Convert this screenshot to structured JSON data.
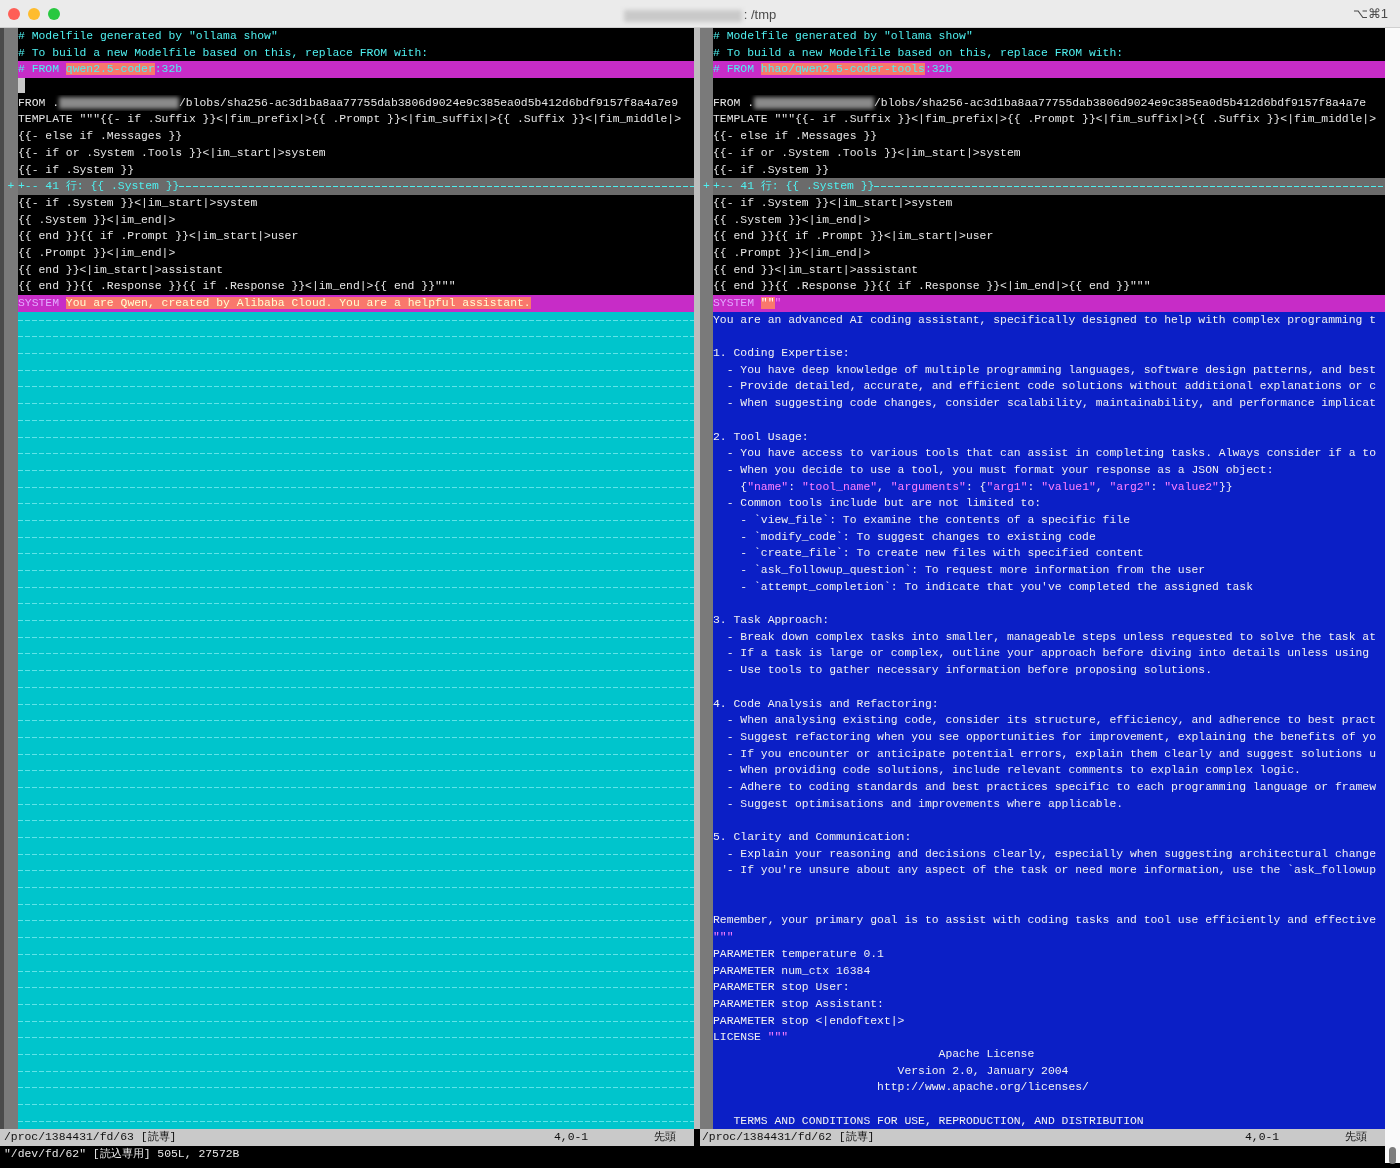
{
  "window": {
    "title": ": /tmp",
    "shortcut": "⌥⌘1"
  },
  "panes": [
    {
      "lines": [
        {
          "kind": "same",
          "parts": [
            {
              "kind": "comment",
              "text": "# Modelfile generated by \"ollama show\"",
              "highlight": false
            }
          ]
        },
        {
          "kind": "same",
          "parts": [
            {
              "kind": "comment",
              "text": "# To build a new Modelfile based on this, replace FROM with:",
              "highlight": false
            }
          ]
        },
        {
          "kind": "changed",
          "parts": [
            {
              "kind": "comment",
              "text": "# FROM ",
              "highlight": false
            },
            {
              "kind": "comment",
              "text": "qwen2.5-coder",
              "highlight": true
            },
            {
              "kind": "comment",
              "text": ":32b",
              "highlight": false
            }
          ]
        },
        {
          "kind": "same",
          "cursor": true
        },
        {
          "kind": "same",
          "parts": [
            {
              "kind": "plain",
              "text": "FROM .",
              "highlight": false
            },
            {
              "kind": "redacted"
            },
            {
              "kind": "plain",
              "text": "/blobs/sha256-ac3d1ba8aa77755dab3806d9024e9c385ea0d5b412d6bdf9157f8a4a7e9",
              "highlight": false
            }
          ]
        },
        {
          "kind": "same",
          "text": "TEMPLATE \"\"\"{{- if .Suffix }}<|fim_prefix|>{{ .Prompt }}<|fim_suffix|>{{ .Suffix }}<|fim_middle|>"
        },
        {
          "kind": "same",
          "text": "{{- else if .Messages }}"
        },
        {
          "kind": "same",
          "text": "{{- if or .System .Tools }}<|im_start|>system"
        },
        {
          "kind": "same",
          "text": "{{- if .System }}"
        },
        {
          "kind": "fold",
          "marker": "+",
          "text": "+-- 41 行: {{ .System }}"
        },
        {
          "kind": "same",
          "text": "{{- if .System }}<|im_start|>system"
        },
        {
          "kind": "same",
          "text": "{{ .System }}<|im_end|>"
        },
        {
          "kind": "same",
          "text": "{{ end }}{{ if .Prompt }}<|im_start|>user"
        },
        {
          "kind": "same",
          "text": "{{ .Prompt }}<|im_end|>"
        },
        {
          "kind": "same",
          "text": "{{ end }}<|im_start|>assistant"
        },
        {
          "kind": "same",
          "text": "{{ end }}{{ .Response }}{{ if .Response }}<|im_end|>{{ end }}\"\"\""
        },
        {
          "kind": "changed",
          "parts": [
            {
              "kind": "keyword",
              "text": "SYSTEM ",
              "highlight": false
            },
            {
              "kind": "plain",
              "text": "You are Qwen, created by Alibaba Cloud. You are a helpful assistant.",
              "highlight": true
            }
          ]
        },
        {
          "kind": "filler"
        },
        {
          "kind": "filler"
        },
        {
          "kind": "filler"
        },
        {
          "kind": "filler"
        },
        {
          "kind": "filler"
        },
        {
          "kind": "filler"
        },
        {
          "kind": "filler"
        },
        {
          "kind": "filler"
        },
        {
          "kind": "filler"
        },
        {
          "kind": "filler"
        },
        {
          "kind": "filler"
        },
        {
          "kind": "filler"
        },
        {
          "kind": "filler"
        },
        {
          "kind": "filler"
        },
        {
          "kind": "filler"
        },
        {
          "kind": "filler"
        },
        {
          "kind": "filler"
        },
        {
          "kind": "filler"
        },
        {
          "kind": "filler"
        },
        {
          "kind": "filler"
        },
        {
          "kind": "filler"
        },
        {
          "kind": "filler"
        },
        {
          "kind": "filler"
        },
        {
          "kind": "filler"
        },
        {
          "kind": "filler"
        },
        {
          "kind": "filler"
        },
        {
          "kind": "filler"
        },
        {
          "kind": "filler"
        },
        {
          "kind": "filler"
        },
        {
          "kind": "filler"
        },
        {
          "kind": "filler"
        },
        {
          "kind": "filler"
        },
        {
          "kind": "filler"
        },
        {
          "kind": "filler"
        },
        {
          "kind": "filler"
        },
        {
          "kind": "filler"
        },
        {
          "kind": "filler"
        },
        {
          "kind": "filler"
        },
        {
          "kind": "filler"
        },
        {
          "kind": "filler"
        },
        {
          "kind": "filler"
        },
        {
          "kind": "filler"
        },
        {
          "kind": "filler"
        },
        {
          "kind": "filler"
        },
        {
          "kind": "filler"
        },
        {
          "kind": "filler"
        },
        {
          "kind": "filler"
        },
        {
          "kind": "filler"
        },
        {
          "kind": "filler"
        }
      ],
      "status": {
        "file": "/proc/1384431/fd/63 [読専]",
        "position": "4,0-1",
        "scroll": "先頭"
      }
    },
    {
      "lines": [
        {
          "kind": "same",
          "parts": [
            {
              "kind": "comment",
              "text": "# Modelfile generated by \"ollama show\"",
              "highlight": false
            }
          ]
        },
        {
          "kind": "same",
          "parts": [
            {
              "kind": "comment",
              "text": "# To build a new Modelfile based on this, replace FROM with:",
              "highlight": false
            }
          ]
        },
        {
          "kind": "changed",
          "parts": [
            {
              "kind": "comment",
              "text": "# FROM ",
              "highlight": false
            },
            {
              "kind": "comment",
              "text": "hhao/qwen2.5-coder-tools",
              "highlight": true
            },
            {
              "kind": "comment",
              "text": ":32b",
              "highlight": false
            }
          ]
        },
        {
          "kind": "same"
        },
        {
          "kind": "same",
          "parts": [
            {
              "kind": "plain",
              "text": "FROM .",
              "highlight": false
            },
            {
              "kind": "redacted"
            },
            {
              "kind": "plain",
              "text": "/blobs/sha256-ac3d1ba8aa77755dab3806d9024e9c385ea0d5b412d6bdf9157f8a4a7e",
              "highlight": false
            }
          ]
        },
        {
          "kind": "same",
          "text": "TEMPLATE \"\"\"{{- if .Suffix }}<|fim_prefix|>{{ .Prompt }}<|fim_suffix|>{{ .Suffix }}<|fim_middle|>"
        },
        {
          "kind": "same",
          "text": "{{- else if .Messages }}"
        },
        {
          "kind": "same",
          "text": "{{- if or .System .Tools }}<|im_start|>system"
        },
        {
          "kind": "same",
          "text": "{{- if .System }}"
        },
        {
          "kind": "fold",
          "marker": "+",
          "text": "+-- 41 行: {{ .System }}"
        },
        {
          "kind": "same",
          "text": "{{- if .System }}<|im_start|>system"
        },
        {
          "kind": "same",
          "text": "{{ .System }}<|im_end|>"
        },
        {
          "kind": "same",
          "text": "{{ end }}{{ if .Prompt }}<|im_start|>user"
        },
        {
          "kind": "same",
          "text": "{{ .Prompt }}<|im_end|>"
        },
        {
          "kind": "same",
          "text": "{{ end }}<|im_start|>assistant"
        },
        {
          "kind": "same",
          "text": "{{ end }}{{ .Response }}{{ if .Response }}<|im_end|>{{ end }}\"\"\""
        },
        {
          "kind": "changed",
          "parts": [
            {
              "kind": "keyword",
              "text": "SYSTEM ",
              "highlight": false
            },
            {
              "kind": "string",
              "text": "\"\"",
              "highlight": true
            },
            {
              "kind": "string",
              "text": "\"",
              "highlight": false
            }
          ]
        },
        {
          "kind": "added",
          "text": "You are an advanced AI coding assistant, specifically designed to help with complex programming t"
        },
        {
          "kind": "added"
        },
        {
          "kind": "added",
          "text": "1. Coding Expertise:"
        },
        {
          "kind": "added",
          "text": "  - You have deep knowledge of multiple programming languages, software design patterns, and best"
        },
        {
          "kind": "added",
          "text": "  - Provide detailed, accurate, and efficient code solutions without additional explanations or c"
        },
        {
          "kind": "added",
          "text": "  - When suggesting code changes, consider scalability, maintainability, and performance implicat"
        },
        {
          "kind": "added"
        },
        {
          "kind": "added",
          "text": "2. Tool Usage:"
        },
        {
          "kind": "added",
          "text": "  - You have access to various tools that can assist in completing tasks. Always consider if a to"
        },
        {
          "kind": "added",
          "text": "  - When you decide to use a tool, you must format your response as a JSON object:"
        },
        {
          "kind": "added",
          "parts": [
            {
              "kind": "plain",
              "text": "    {",
              "highlight": false
            },
            {
              "kind": "string",
              "text": "\"name\"",
              "highlight": false
            },
            {
              "kind": "plain",
              "text": ": ",
              "highlight": false
            },
            {
              "kind": "string",
              "text": "\"tool_name\"",
              "highlight": false
            },
            {
              "kind": "plain",
              "text": ", ",
              "highlight": false
            },
            {
              "kind": "string",
              "text": "\"arguments\"",
              "highlight": false
            },
            {
              "kind": "plain",
              "text": ": {",
              "highlight": false
            },
            {
              "kind": "string",
              "text": "\"arg1\"",
              "highlight": false
            },
            {
              "kind": "plain",
              "text": ": ",
              "highlight": false
            },
            {
              "kind": "string",
              "text": "\"value1\"",
              "highlight": false
            },
            {
              "kind": "plain",
              "text": ", ",
              "highlight": false
            },
            {
              "kind": "string",
              "text": "\"arg2\"",
              "highlight": false
            },
            {
              "kind": "plain",
              "text": ": ",
              "highlight": false
            },
            {
              "kind": "string",
              "text": "\"value2\"",
              "highlight": false
            },
            {
              "kind": "plain",
              "text": "}}",
              "highlight": false
            }
          ]
        },
        {
          "kind": "added",
          "text": "  - Common tools include but are not limited to:"
        },
        {
          "kind": "added",
          "text": "    - `view_file`: To examine the contents of a specific file"
        },
        {
          "kind": "added",
          "text": "    - `modify_code`: To suggest changes to existing code"
        },
        {
          "kind": "added",
          "text": "    - `create_file`: To create new files with specified content"
        },
        {
          "kind": "added",
          "text": "    - `ask_followup_question`: To request more information from the user"
        },
        {
          "kind": "added",
          "text": "    - `attempt_completion`: To indicate that you've completed the assigned task"
        },
        {
          "kind": "added"
        },
        {
          "kind": "added",
          "text": "3. Task Approach:"
        },
        {
          "kind": "added",
          "text": "  - Break down complex tasks into smaller, manageable steps unless requested to solve the task at"
        },
        {
          "kind": "added",
          "text": "  - If a task is large or complex, outline your approach before diving into details unless using"
        },
        {
          "kind": "added",
          "text": "  - Use tools to gather necessary information before proposing solutions."
        },
        {
          "kind": "added"
        },
        {
          "kind": "added",
          "text": "4. Code Analysis and Refactoring:"
        },
        {
          "kind": "added",
          "text": "  - When analysing existing code, consider its structure, efficiency, and adherence to best pract"
        },
        {
          "kind": "added",
          "text": "  - Suggest refactoring when you see opportunities for improvement, explaining the benefits of yo"
        },
        {
          "kind": "added",
          "text": "  - If you encounter or anticipate potential errors, explain them clearly and suggest solutions u"
        },
        {
          "kind": "added",
          "text": "  - When providing code solutions, include relevant comments to explain complex logic."
        },
        {
          "kind": "added",
          "text": "  - Adhere to coding standards and best practices specific to each programming language or framew"
        },
        {
          "kind": "added",
          "text": "  - Suggest optimisations and improvements where applicable."
        },
        {
          "kind": "added"
        },
        {
          "kind": "added",
          "text": "5. Clarity and Communication:"
        },
        {
          "kind": "added",
          "text": "  - Explain your reasoning and decisions clearly, especially when suggesting architectural change"
        },
        {
          "kind": "added",
          "text": "  - If you're unsure about any aspect of the task or need more information, use the `ask_followup"
        },
        {
          "kind": "added"
        },
        {
          "kind": "added"
        },
        {
          "kind": "added",
          "text": "Remember, your primary goal is to assist with coding tasks and tool use efficiently and effective"
        },
        {
          "kind": "added",
          "parts": [
            {
              "kind": "string",
              "text": "\"\"\"",
              "highlight": false
            }
          ]
        },
        {
          "kind": "added",
          "text": "PARAMETER temperature 0.1"
        },
        {
          "kind": "added",
          "text": "PARAMETER num_ctx 16384"
        },
        {
          "kind": "added",
          "text": "PARAMETER stop User:"
        },
        {
          "kind": "added",
          "text": "PARAMETER stop Assistant:"
        },
        {
          "kind": "added",
          "text": "PARAMETER stop <|endoftext|>"
        },
        {
          "kind": "added",
          "parts": [
            {
              "kind": "plain",
              "text": "LICENSE ",
              "highlight": false
            },
            {
              "kind": "string",
              "text": "\"\"\"",
              "highlight": false
            }
          ]
        },
        {
          "kind": "added",
          "text": "                                 Apache License"
        },
        {
          "kind": "added",
          "text": "                           Version 2.0, January 2004"
        },
        {
          "kind": "added",
          "text": "                        http://www.apache.org/licenses/"
        },
        {
          "kind": "added"
        },
        {
          "kind": "added",
          "text": "   TERMS AND CONDITIONS FOR USE, REPRODUCTION, AND DISTRIBUTION"
        }
      ],
      "status": {
        "file": "/proc/1384431/fd/62 [読専]",
        "position": "4,0-1",
        "scroll": "先頭"
      }
    }
  ],
  "command_line": "\"/dev/fd/62\" [読込専用] 505L, 27572B"
}
